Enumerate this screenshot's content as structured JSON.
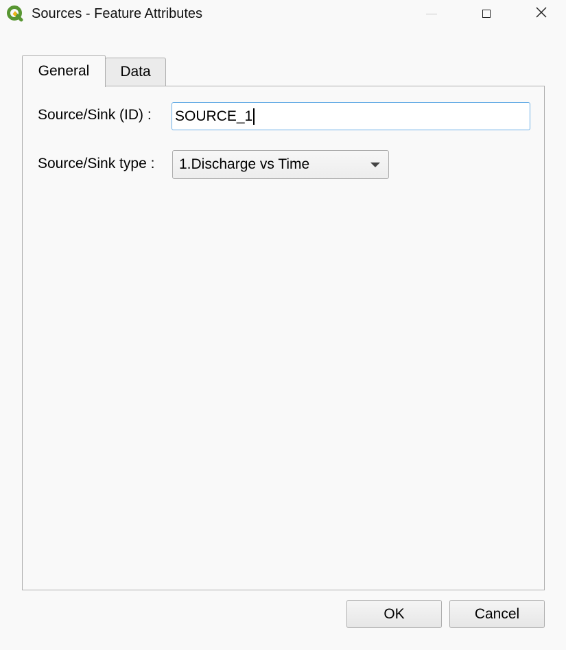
{
  "window": {
    "title": "Sources - Feature Attributes",
    "app_icon": "qgis-logo-icon",
    "controls": [
      "minimize-icon",
      "maximize-icon",
      "close-icon"
    ]
  },
  "tabs": [
    {
      "label": "General",
      "active": true
    },
    {
      "label": "Data",
      "active": false
    }
  ],
  "general": {
    "id_label": "Source/Sink (ID) :",
    "id_value": "SOURCE_1",
    "type_label": "Source/Sink type :",
    "type_value": "1.Discharge vs Time"
  },
  "buttons": {
    "ok": "OK",
    "cancel": "Cancel"
  },
  "colors": {
    "accent_focus": "#6aaee6",
    "qgis_green": "#589632",
    "qgis_yellow": "#eeb416"
  }
}
